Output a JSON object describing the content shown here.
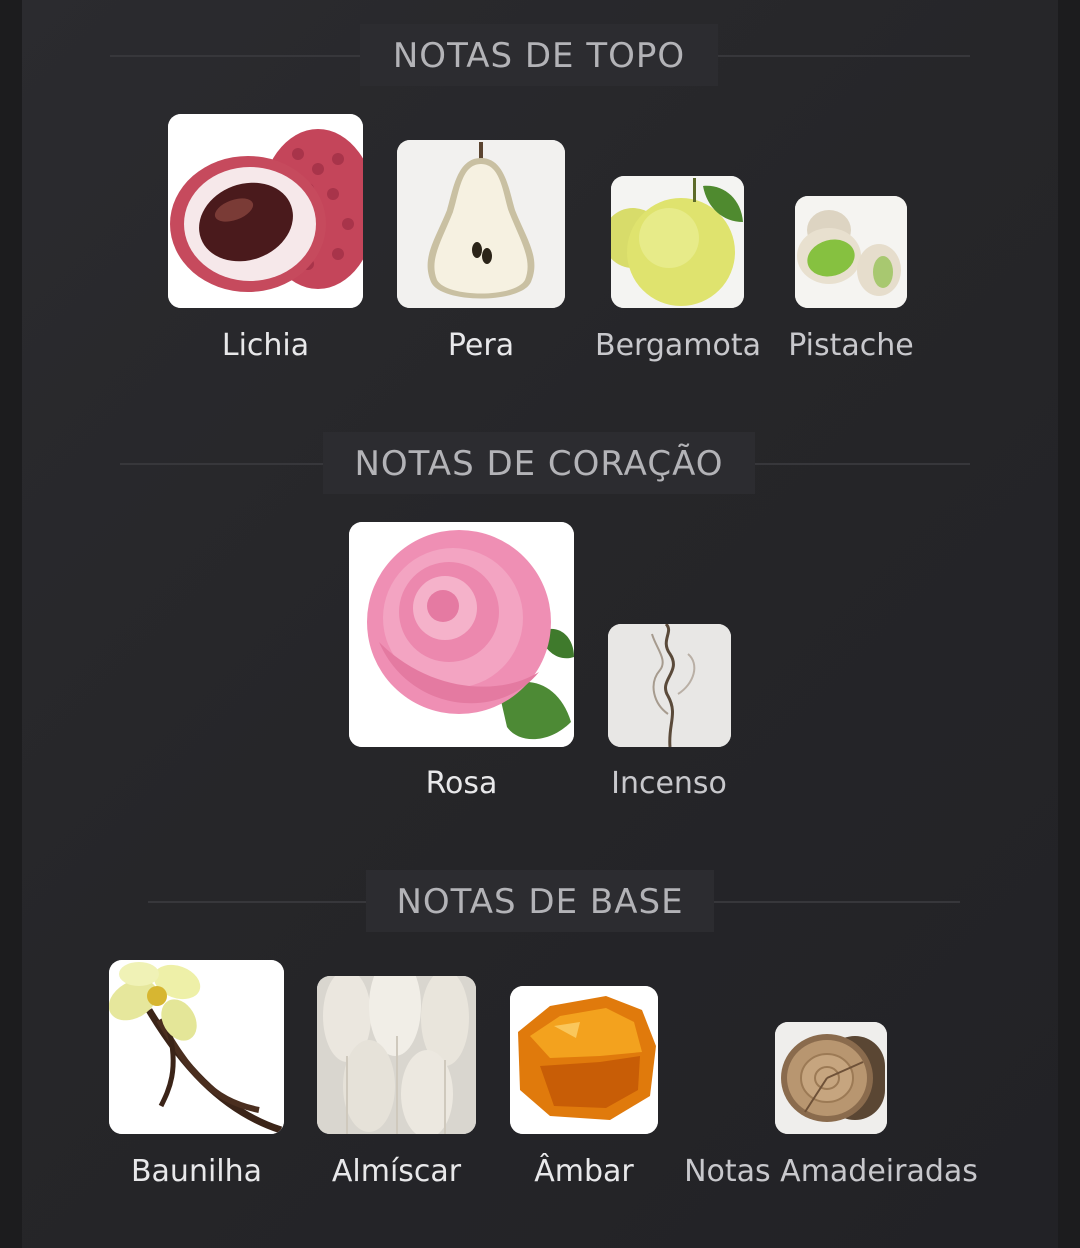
{
  "sections": {
    "top": {
      "title": "NOTAS DE TOPO",
      "notes": [
        {
          "label": "Lichia",
          "icon": "lychee-icon"
        },
        {
          "label": "Pera",
          "icon": "pear-icon"
        },
        {
          "label": "Bergamota",
          "icon": "bergamot-icon"
        },
        {
          "label": "Pistache",
          "icon": "pistachio-icon"
        }
      ]
    },
    "heart": {
      "title": "NOTAS DE CORAÇÃO",
      "notes": [
        {
          "label": "Rosa",
          "icon": "rose-icon"
        },
        {
          "label": "Incenso",
          "icon": "incense-icon"
        }
      ]
    },
    "base": {
      "title": "NOTAS DE BASE",
      "notes": [
        {
          "label": "Baunilha",
          "icon": "vanilla-icon"
        },
        {
          "label": "Almíscar",
          "icon": "musk-icon"
        },
        {
          "label": "Âmbar",
          "icon": "amber-icon"
        },
        {
          "label": "Notas Amadeiradas",
          "icon": "wood-icon"
        }
      ]
    }
  },
  "colors": {
    "background": "#1c1c1e",
    "panel": "#262629",
    "title_text": "#b3b3b7",
    "label_text": "#e8e8ea"
  }
}
